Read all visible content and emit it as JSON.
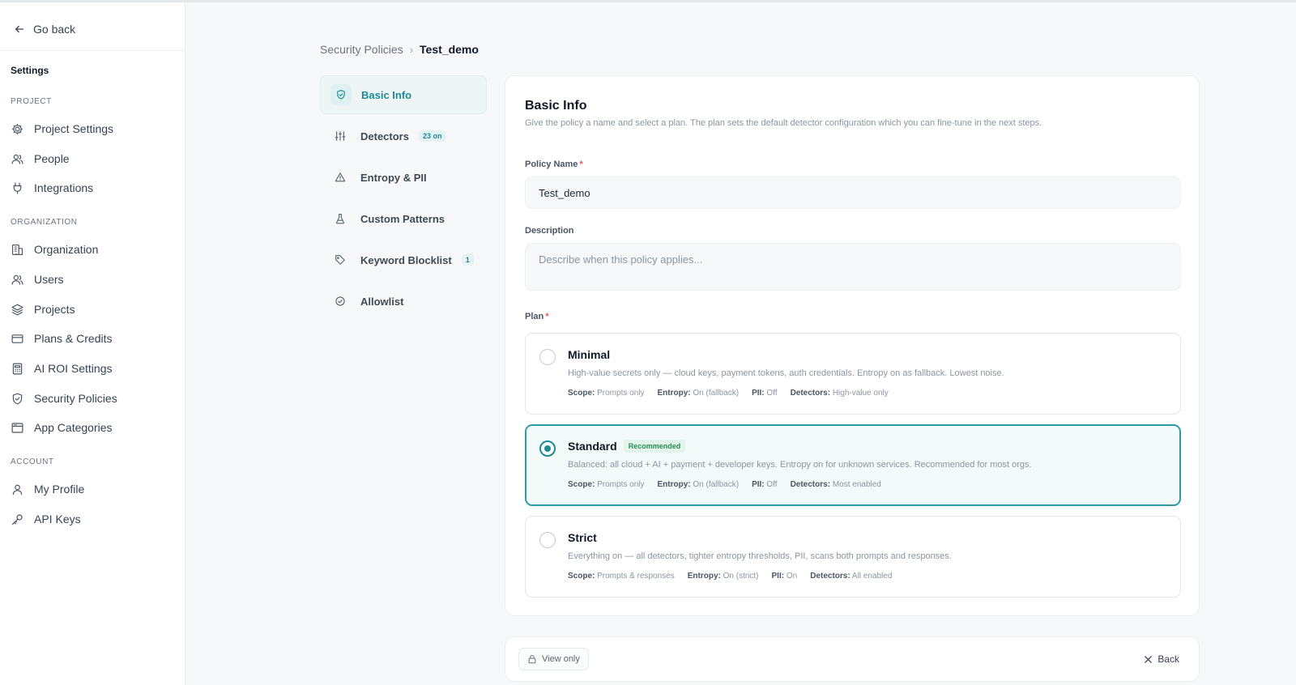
{
  "sidebar": {
    "go_back": "Go back",
    "title": "Settings",
    "sections": {
      "project": "PROJECT",
      "organization": "ORGANIZATION",
      "account": "ACCOUNT"
    },
    "items": {
      "project_settings": "Project Settings",
      "people": "People",
      "integrations": "Integrations",
      "organization": "Organization",
      "users": "Users",
      "projects": "Projects",
      "plans_credits": "Plans & Credits",
      "ai_roi": "AI ROI Settings",
      "security_policies": "Security Policies",
      "app_categories": "App Categories",
      "my_profile": "My Profile",
      "api_keys": "API Keys"
    }
  },
  "breadcrumb": {
    "parent": "Security Policies",
    "separator": "›",
    "current": "Test_demo"
  },
  "steps": {
    "basic_info": "Basic Info",
    "detectors": "Detectors",
    "detectors_badge": "23 on",
    "entropy_pii": "Entropy & PII",
    "custom_patterns": "Custom Patterns",
    "keyword_blocklist": "Keyword Blocklist",
    "keyword_blocklist_badge": "1",
    "allowlist": "Allowlist"
  },
  "form": {
    "title": "Basic Info",
    "subtitle": "Give the policy a name and select a plan. The plan sets the default detector configuration which you can fine-tune in the next steps.",
    "policy_name_label": "Policy Name",
    "policy_name_value": "Test_demo",
    "description_label": "Description",
    "description_placeholder": "Describe when this policy applies...",
    "plan_label": "Plan",
    "required_mark": "*"
  },
  "plans": {
    "minimal": {
      "name": "Minimal",
      "desc": "High-value secrets only — cloud keys, payment tokens, auth credentials. Entropy on as fallback. Lowest noise.",
      "scope_label": "Scope:",
      "scope": "Prompts only",
      "entropy_label": "Entropy:",
      "entropy": "On (fallback)",
      "pii_label": "PII:",
      "pii": "Off",
      "detectors_label": "Detectors:",
      "detectors": "High-value only"
    },
    "standard": {
      "name": "Standard",
      "badge": "Recommended",
      "desc": "Balanced: all cloud + AI + payment + developer keys. Entropy on for unknown services. Recommended for most orgs.",
      "scope_label": "Scope:",
      "scope": "Prompts only",
      "entropy_label": "Entropy:",
      "entropy": "On (fallback)",
      "pii_label": "PII:",
      "pii": "Off",
      "detectors_label": "Detectors:",
      "detectors": "Most enabled"
    },
    "strict": {
      "name": "Strict",
      "desc": "Everything on — all detectors, tighter entropy thresholds, PII, scans both prompts and responses.",
      "scope_label": "Scope:",
      "scope": "Prompts & responses",
      "entropy_label": "Entropy:",
      "entropy": "On (strict)",
      "pii_label": "PII:",
      "pii": "On",
      "detectors_label": "Detectors:",
      "detectors": "All enabled"
    },
    "selected": "standard"
  },
  "footer": {
    "view_only": "View only",
    "back": "Back"
  },
  "colors": {
    "accent": "#1f8a96",
    "selected_border": "#2f9aa6",
    "recommended_green": "#2a8a55",
    "required_red": "#e0565a"
  }
}
